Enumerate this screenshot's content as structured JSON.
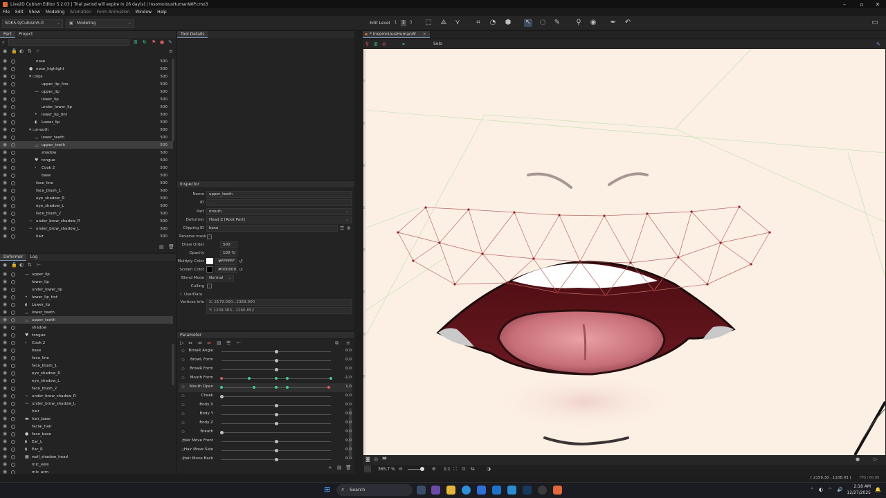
{
  "titlebar": {
    "title": "Live2D Cubism Editor 5.2.03   |   Trial period will expire in 26 day(s)   |   InsomniousHumanWIP.cmo3"
  },
  "menu": [
    "File",
    "Edit",
    "Show",
    "Modeling",
    "Animation",
    "Form Animation",
    "Window",
    "Help"
  ],
  "toolbar": {
    "sdk": "SDK5.0/Cubism5.0",
    "mode": "Modeling",
    "edit_level_label": "Edit Level",
    "edit_level_values": [
      "1",
      "2",
      "3"
    ]
  },
  "left_top_tabs": [
    "Part",
    "Project"
  ],
  "tool_details_tab": "Tool Details",
  "canvas_tab": "* InsomniousHumanW",
  "canvas_tab_close": "×",
  "canvas_toolbar_solo": "Solo",
  "part_tree": [
    {
      "label": "nose",
      "value": "500",
      "indent": 0,
      "glyph": ""
    },
    {
      "label": "nose_highlight",
      "value": "500",
      "indent": 0,
      "glyph": "●"
    },
    {
      "label": "lips",
      "value": "500",
      "indent": 0,
      "glyph": "▾ ▭"
    },
    {
      "label": "upper_lip_line",
      "value": "500",
      "indent": 1,
      "glyph": ""
    },
    {
      "label": "upper_lip",
      "value": "500",
      "indent": 1,
      "glyph": "—"
    },
    {
      "label": "lower_lip",
      "value": "500",
      "indent": 1,
      "glyph": ""
    },
    {
      "label": "under_lower_lip",
      "value": "500",
      "indent": 1,
      "glyph": ""
    },
    {
      "label": "lower_lip_tint",
      "value": "500",
      "indent": 1,
      "glyph": "•"
    },
    {
      "label": "Lower_lip",
      "value": "500",
      "indent": 1,
      "glyph": "◖"
    },
    {
      "label": "mouth",
      "value": "500",
      "indent": 0,
      "glyph": "▾ ▭"
    },
    {
      "label": "lower_teeth",
      "value": "500",
      "indent": 1,
      "glyph": "◡"
    },
    {
      "label": "upper_teeth",
      "value": "500",
      "indent": 1,
      "glyph": "◡"
    },
    {
      "label": "shadow",
      "value": "500",
      "indent": 1,
      "glyph": ""
    },
    {
      "label": "tongue",
      "value": "500",
      "indent": 1,
      "glyph": "♥"
    },
    {
      "label": "Cook 2",
      "value": "500",
      "indent": 1,
      "glyph": "›"
    },
    {
      "label": "base",
      "value": "500",
      "indent": 1,
      "glyph": ""
    },
    {
      "label": "face_line",
      "value": "500",
      "indent": 0,
      "glyph": ""
    },
    {
      "label": "face_blush_1",
      "value": "500",
      "indent": 0,
      "glyph": ""
    },
    {
      "label": "eye_shadow_R",
      "value": "500",
      "indent": 0,
      "glyph": ""
    },
    {
      "label": "eye_shadow_L",
      "value": "500",
      "indent": 0,
      "glyph": ""
    },
    {
      "label": "face_blush_2",
      "value": "500",
      "indent": 0,
      "glyph": ""
    },
    {
      "label": "under_brow_shadow_R",
      "value": "500",
      "indent": 0,
      "glyph": "~"
    },
    {
      "label": "under_brow_shadow_L",
      "value": "500",
      "indent": 0,
      "glyph": "~"
    },
    {
      "label": "hair",
      "value": "500",
      "indent": 0,
      "glyph": ""
    }
  ],
  "left_bottom_tabs": [
    "Deformer",
    "Log"
  ],
  "deformer_tree": [
    {
      "label": "upper_lip",
      "glyph": "—"
    },
    {
      "label": "lower_lip",
      "glyph": ""
    },
    {
      "label": "under_lower_lip",
      "glyph": ""
    },
    {
      "label": "lower_lip_tint",
      "glyph": "•"
    },
    {
      "label": "Lower_lip",
      "glyph": "◖"
    },
    {
      "label": "lower_teeth",
      "glyph": "◡"
    },
    {
      "label": "upper_teeth",
      "glyph": "◡"
    },
    {
      "label": "shadow",
      "glyph": ""
    },
    {
      "label": "tongue",
      "glyph": "♥"
    },
    {
      "label": "Cook 2",
      "glyph": "›"
    },
    {
      "label": "base",
      "glyph": ""
    },
    {
      "label": "face_line",
      "glyph": ""
    },
    {
      "label": "face_blush_1",
      "glyph": ""
    },
    {
      "label": "eye_shadow_R",
      "glyph": ""
    },
    {
      "label": "eye_shadow_L",
      "glyph": ""
    },
    {
      "label": "face_blush_2",
      "glyph": ""
    },
    {
      "label": "under_brow_shadow_R",
      "glyph": "~"
    },
    {
      "label": "under_brow_shadow_L",
      "glyph": "~"
    },
    {
      "label": "hair",
      "glyph": ""
    },
    {
      "label": "hair_base",
      "glyph": "▬"
    },
    {
      "label": "facial_hair",
      "glyph": ""
    },
    {
      "label": "face_base",
      "glyph": "●"
    },
    {
      "label": "Ear_L",
      "glyph": "◗"
    },
    {
      "label": "Ear_R",
      "glyph": "◖"
    },
    {
      "label": "wall_shadow_head",
      "glyph": "▦"
    },
    {
      "label": "mic_wire",
      "glyph": ""
    },
    {
      "label": "mic_arm",
      "glyph": ""
    }
  ],
  "inspector": {
    "header": "Inspector",
    "name_label": "Name",
    "name_value": "upper_teeth",
    "id_label": "ID",
    "id_value": "...",
    "part_label": "Part",
    "part_value": "mouth",
    "deformer_label": "Deformer",
    "deformer_value": "Head Z  [Root Part]",
    "clipping_label": "Clipping ID",
    "clipping_value": "base",
    "reverse_mask_label": "Reverse mask",
    "draw_order_label": "Draw Order",
    "draw_order_value": "500",
    "opacity_label": "Opacity",
    "opacity_value": "100 %",
    "multiply_label": "Multiply Color",
    "multiply_value": "#FFFFFF",
    "screen_label": "Screen Color",
    "screen_value": "#000000",
    "blend_label": "Blend Mode",
    "blend_value": "Normal",
    "culling_label": "Culling",
    "userdata_label": "UserData",
    "vertices_label": "Vertices Info",
    "vertices_x": "X: 2179.000...2369.000",
    "vertices_y": "Y: 1209.383...1260.852"
  },
  "parameter": {
    "header": "Parameter",
    "rows": [
      {
        "name": "BrowR Angle",
        "value": "0.0",
        "pos": 0.5,
        "keys": []
      },
      {
        "name": "BrowL Form",
        "value": "0.0",
        "pos": 0.5,
        "keys": []
      },
      {
        "name": "BrowR Form",
        "value": "0.0",
        "pos": 0.5,
        "keys": []
      },
      {
        "name": "Mouth Form",
        "value": "-1.0",
        "pos": 0.0,
        "keys": [
          0.25,
          0.5,
          0.6,
          1.0
        ],
        "reds": [
          0.0
        ]
      },
      {
        "name": "Mouth Open",
        "value": "1.0",
        "pos": 1.0,
        "keys": [
          0.0,
          0.3,
          0.5,
          0.6
        ],
        "reds": [
          0.98
        ]
      },
      {
        "name": "Cheek",
        "value": "0.0",
        "pos": 0.0,
        "keys": []
      },
      {
        "name": "Body X",
        "value": "0.0",
        "pos": 0.5,
        "keys": []
      },
      {
        "name": "Body Y",
        "value": "0.0",
        "pos": 0.5,
        "keys": []
      },
      {
        "name": "Body Z",
        "value": "0.0",
        "pos": 0.5,
        "keys": []
      },
      {
        "name": "Breath",
        "value": "0.0",
        "pos": 0.0,
        "keys": []
      },
      {
        "name": "Hair Move Front",
        "value": "0.0",
        "pos": 0.5,
        "keys": []
      },
      {
        "name": "Hair Move Side",
        "value": "0.0",
        "pos": 0.5,
        "keys": []
      },
      {
        "name": "Hair Move Back",
        "value": "0.0",
        "pos": 0.5,
        "keys": []
      }
    ]
  },
  "ruler_labels": [
    "900",
    "800",
    "700",
    "600",
    "500",
    "400",
    "300",
    "200"
  ],
  "canvas_bottom": {
    "zoom": "365.7 %",
    "ratio": "1:1"
  },
  "status": {
    "coords": "[ 2159.30 , 1108.93 ]",
    "fps": "FPS / 60.00"
  },
  "taskbar": {
    "search": "Search",
    "time": "2:18 AM",
    "date": "12/27/2025"
  },
  "colors": {
    "canvas_bg": "#fcefe4",
    "mesh_line": "#b05a5a",
    "accent": "#3fcf8e",
    "selection": "#3e3e3e"
  }
}
